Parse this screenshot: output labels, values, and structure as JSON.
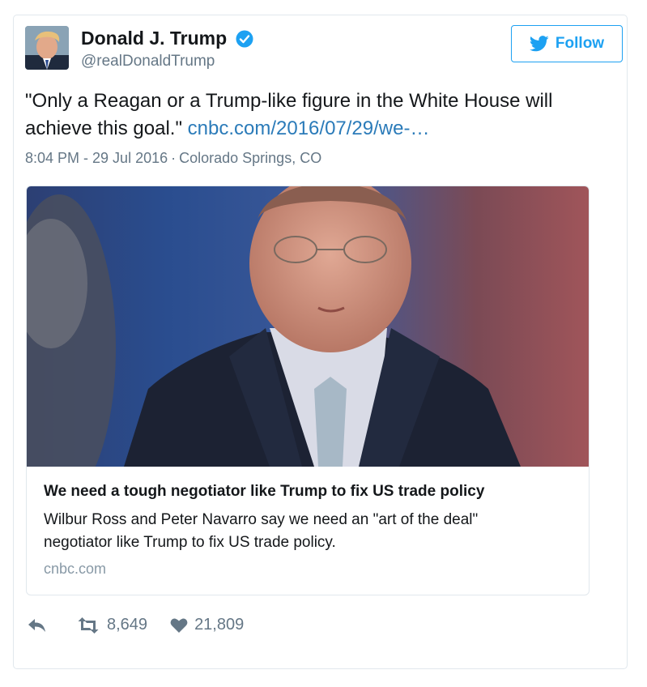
{
  "author": {
    "name": "Donald J. Trump",
    "handle": "@realDonaldTrump",
    "verified_icon": "verified-badge-icon"
  },
  "follow": {
    "label": "Follow",
    "icon": "twitter-bird-icon"
  },
  "tweet": {
    "text_line1": "\"Only a Reagan or a Trump-like figure in the White House will",
    "text_line2": "achieve this goal.\"",
    "link": "cnbc.com/2016/07/29/we-…",
    "time": "8:04 PM - 29 Jul 2016",
    "separator": "·",
    "location": "Colorado Springs, CO"
  },
  "card": {
    "title": "We need a tough negotiator like Trump to fix US trade policy",
    "description_line1": "Wilbur Ross and Peter Navarro say we need an \"art of the deal\"",
    "description_line2": "negotiator like Trump to fix US trade policy.",
    "domain": "cnbc.com"
  },
  "actions": {
    "reply_icon": "reply-icon",
    "retweet_icon": "retweet-icon",
    "retweets": "8,649",
    "like_icon": "heart-icon",
    "likes": "21,809"
  },
  "colors": {
    "accent": "#1da1f2",
    "link": "#2b7bb9",
    "muted": "#657786",
    "border": "#e1e8ed"
  }
}
